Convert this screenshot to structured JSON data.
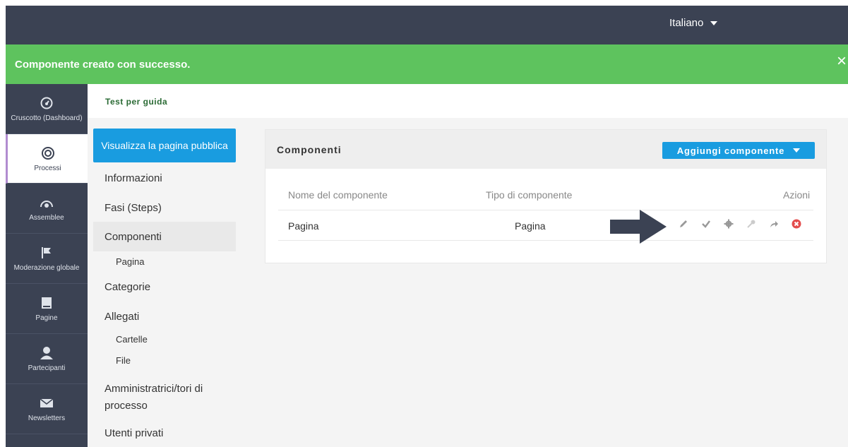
{
  "topbar": {
    "language": "Italiano"
  },
  "flash": {
    "message": "Componente creato con successo.",
    "close": "×"
  },
  "sidenav": {
    "items": [
      {
        "label": "Cruscotto (Dashboard)",
        "icon": "dashboard-icon"
      },
      {
        "label": "Processi",
        "icon": "processes-icon",
        "active": true
      },
      {
        "label": "Assemblee",
        "icon": "assemblies-icon"
      },
      {
        "label": "Moderazione globale",
        "icon": "flag-icon"
      },
      {
        "label": "Pagine",
        "icon": "book-icon"
      },
      {
        "label": "Partecipanti",
        "icon": "user-icon"
      },
      {
        "label": "Newsletters",
        "icon": "envelope-icon"
      }
    ]
  },
  "subheader": {
    "title": "Test per guida"
  },
  "secnav": {
    "public_button": "Visualizza la pagina pubblica",
    "items": [
      "Informazioni",
      "Fasi (Steps)",
      "Componenti",
      "Pagina",
      "Categorie",
      "Allegati",
      "Cartelle",
      "File",
      "Amministratrici/tori di processo",
      "Utenti privati"
    ]
  },
  "card": {
    "title": "Componenti",
    "add_button": "Aggiungi componente",
    "columns": [
      "Nome del componente",
      "Tipo di componente",
      "Azioni"
    ],
    "rows": [
      {
        "name": "Pagina",
        "type": "Pagina"
      }
    ],
    "action_icons": [
      "pencil-icon",
      "check-icon",
      "gear-icon",
      "key-icon",
      "share-icon",
      "delete-icon"
    ]
  },
  "colors": {
    "topbar": "#3b4253",
    "flash": "#5ec35e",
    "accent": "#199ce0",
    "active_border": "#b18cd0"
  }
}
